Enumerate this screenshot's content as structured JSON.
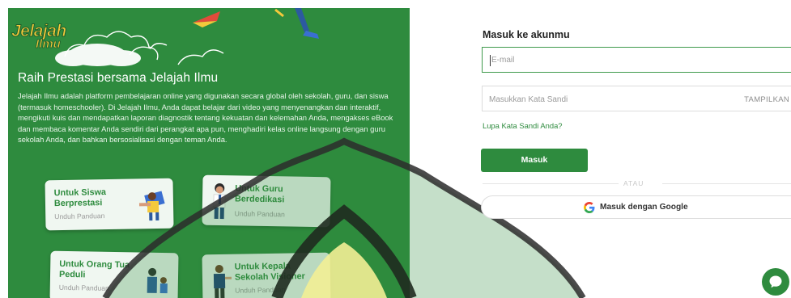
{
  "brand": {
    "logo_line1": "Jelajah",
    "logo_line2": "Ilmu"
  },
  "hero": {
    "title": "Raih Prestasi bersama Jelajah Ilmu",
    "description": "Jelajah Ilmu adalah platform pembelajaran online yang digunakan secara global oleh sekolah, guru, dan siswa (termasuk homeschooler). Di Jelajah Ilmu, Anda dapat belajar dari video yang menyenangkan dan interaktif, mengikuti kuis dan mendapatkan laporan diagnostik tentang kekuatan dan kelemahan Anda, mengakses eBook dan membaca komentar Anda sendiri dari perangkat apa pun, menghadiri kelas online langsung dengan guru sekolah Anda, dan bahkan bersosialisasi dengan teman Anda."
  },
  "cards": [
    {
      "title": "Untuk Siswa Berprestasi",
      "subtitle": "Unduh Panduan"
    },
    {
      "title": "Untuk Guru Berdedikasi",
      "subtitle": "Unduh Panduan"
    },
    {
      "title": "Untuk Orang Tua Peduli",
      "subtitle": "Unduh Panduan"
    },
    {
      "title": "Untuk Kepala Sekolah Visioner",
      "subtitle": "Unduh Panduan"
    }
  ],
  "login": {
    "title": "Masuk ke akunmu",
    "email_placeholder": "E-mail",
    "password_placeholder": "Masukkan Kata Sandi",
    "show_password": "TAMPILKAN",
    "forgot": "Lupa Kata Sandi Anda?",
    "submit": "Masuk",
    "divider": "ATAU",
    "google": "Masuk dengan Google"
  },
  "colors": {
    "brand_green": "#2e8b3e",
    "logo_yellow": "#f4c93b",
    "google_blue": "#4285f4",
    "google_red": "#ea4335",
    "google_yellow": "#fbbc05",
    "google_green": "#34a853"
  },
  "icons": {
    "chat": "chat-bubble-icon",
    "google": "google-g-icon"
  }
}
